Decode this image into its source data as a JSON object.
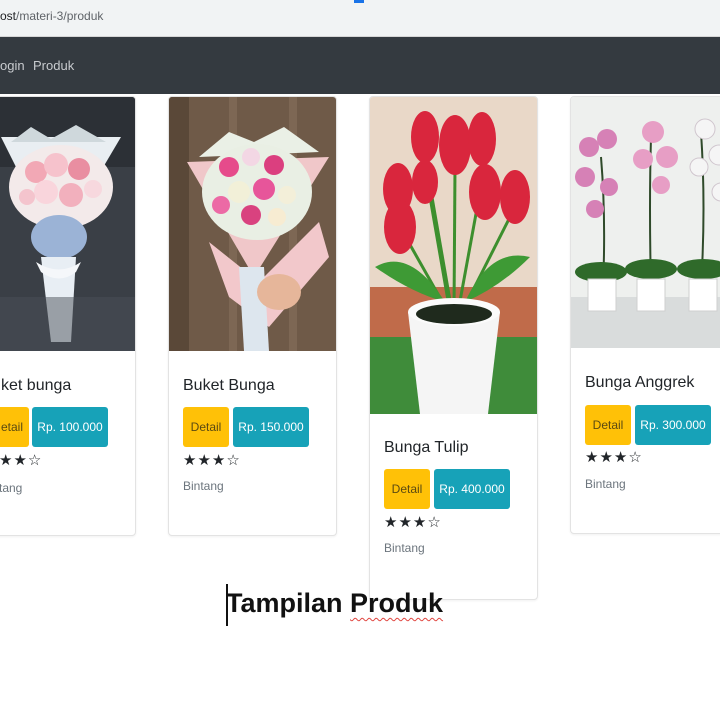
{
  "browser": {
    "url_host": "ost",
    "url_path": "/materi-3/produk"
  },
  "navbar": {
    "links": [
      "ogin",
      "Produk"
    ]
  },
  "products": [
    {
      "title": "ket bunga",
      "detail_label": "etail",
      "price_label": "Rp. 100.000",
      "stars": "★★☆",
      "rating_label": "tang"
    },
    {
      "title": "Buket Bunga",
      "detail_label": "Detail",
      "price_label": "Rp. 150.000",
      "stars": "★★★☆",
      "rating_label": "Bintang"
    },
    {
      "title": "Bunga Tulip",
      "detail_label": "Detail",
      "price_label": "Rp. 400.000",
      "stars": "★★★☆",
      "rating_label": "Bintang"
    },
    {
      "title": "Bunga Anggrek",
      "detail_label": "Detail",
      "price_label": "Rp. 300.000",
      "stars": "★★★☆",
      "rating_label": "Bintang"
    }
  ],
  "caption": {
    "prefix": "Tampilan ",
    "word": "Produk"
  }
}
